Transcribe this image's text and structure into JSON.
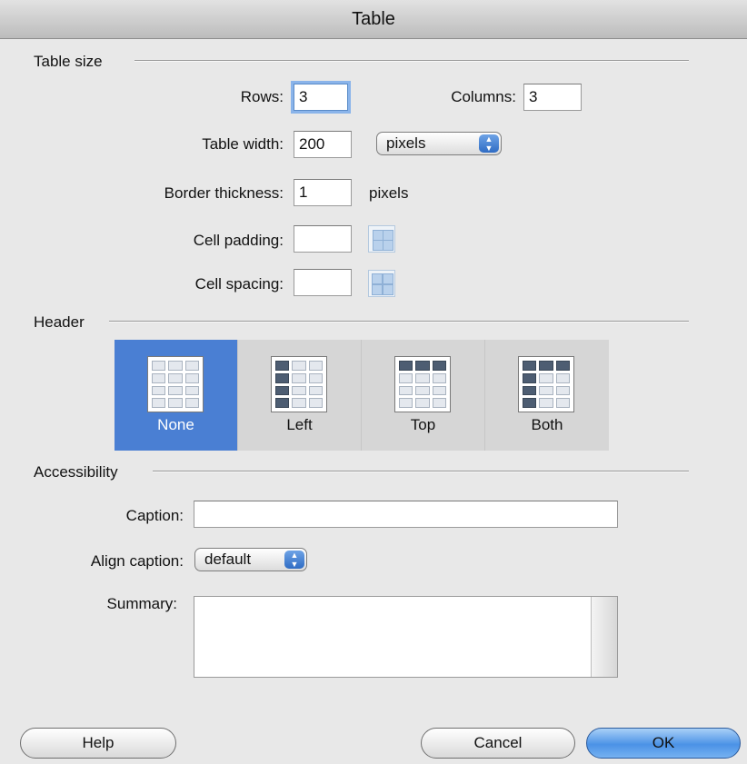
{
  "window": {
    "title": "Table"
  },
  "table_size": {
    "section_title": "Table size",
    "rows_label": "Rows:",
    "rows_value": "3",
    "columns_label": "Columns:",
    "columns_value": "3",
    "width_label": "Table width:",
    "width_value": "200",
    "width_unit": "pixels",
    "border_label": "Border thickness:",
    "border_value": "1",
    "border_unit": "pixels",
    "padding_label": "Cell padding:",
    "padding_value": "",
    "spacing_label": "Cell spacing:",
    "spacing_value": ""
  },
  "header": {
    "section_title": "Header",
    "options": [
      {
        "label": "None",
        "selected": true,
        "icon": "table-no-header-icon"
      },
      {
        "label": "Left",
        "selected": false,
        "icon": "table-left-header-icon"
      },
      {
        "label": "Top",
        "selected": false,
        "icon": "table-top-header-icon"
      },
      {
        "label": "Both",
        "selected": false,
        "icon": "table-both-header-icon"
      }
    ]
  },
  "accessibility": {
    "section_title": "Accessibility",
    "caption_label": "Caption:",
    "caption_value": "",
    "align_label": "Align caption:",
    "align_value": "default",
    "summary_label": "Summary:",
    "summary_value": ""
  },
  "buttons": {
    "help": "Help",
    "cancel": "Cancel",
    "ok": "OK"
  },
  "colors": {
    "selected": "#4a7fd3",
    "default_button": "#4b92e6",
    "focus_ring": "#8ab4ea"
  }
}
